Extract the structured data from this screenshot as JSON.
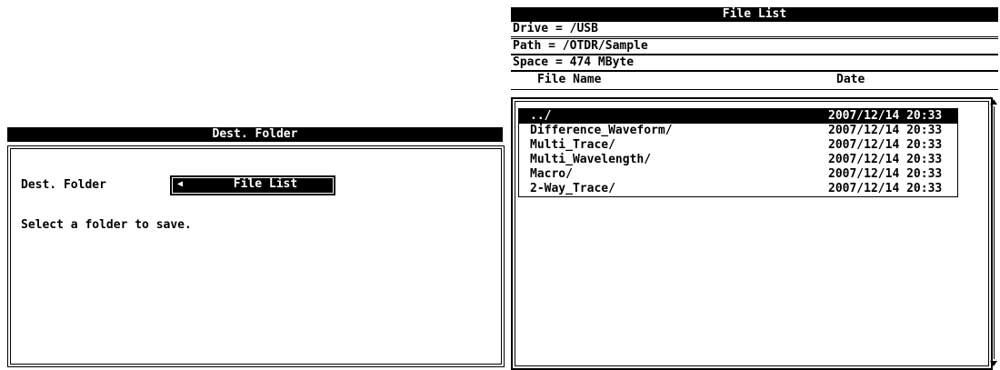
{
  "dest_dialog": {
    "title": "Dest. Folder",
    "label": "Dest. Folder",
    "selected_value": "File List",
    "message": "Select a folder to save."
  },
  "file_list": {
    "title": "File List",
    "drive": "Drive = /USB",
    "path": "Path = /OTDR/Sample",
    "space": "Space = 474 MByte",
    "columns": {
      "name": "File Name",
      "date": "Date"
    },
    "rows": [
      {
        "name": "../",
        "date": "2007/12/14 20:33"
      },
      {
        "name": "Difference_Waveform/",
        "date": "2007/12/14 20:33"
      },
      {
        "name": "Multi_Trace/",
        "date": "2007/12/14 20:33"
      },
      {
        "name": "Multi_Wavelength/",
        "date": "2007/12/14 20:33"
      },
      {
        "name": "Macro/",
        "date": "2007/12/14 20:33"
      },
      {
        "name": "2-Way_Trace/",
        "date": "2007/12/14 20:33"
      }
    ]
  }
}
